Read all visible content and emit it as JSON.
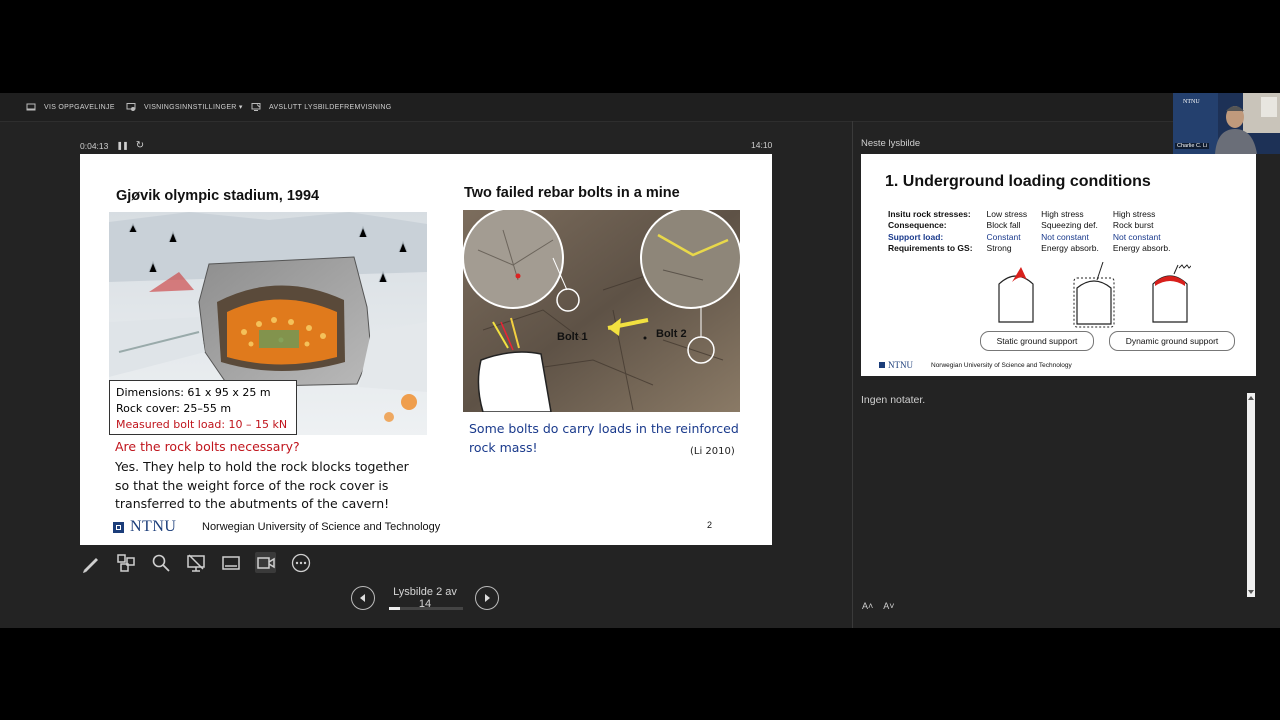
{
  "topbar": {
    "items": [
      {
        "label": "VIS OPPGAVELINJE",
        "icon": "taskbar-icon"
      },
      {
        "label": "VISNINGSINNSTILLINGER ▾",
        "icon": "display-settings-icon"
      },
      {
        "label": "AVSLUTT LYSBILDEFREMVISNING",
        "icon": "end-slideshow-icon"
      }
    ]
  },
  "timer": {
    "elapsed": "0:04:13",
    "clock": "14:10"
  },
  "slide": {
    "left_title": "Gjøvik olympic stadium, 1994",
    "right_title": "Two failed rebar bolts in a mine",
    "info": {
      "line1": "Dimensions: 61 x 95 x 25 m",
      "line2": "Rock cover: 25–55 m",
      "line3": "Measured bolt load: 10 – 15 kN"
    },
    "question": "Are the rock bolts necessary?",
    "answer": "Yes. They help to hold the rock blocks together so that the weight force of the rock cover is transferred to the abutments of the cavern!",
    "bolt1": "Bolt 1",
    "bolt2": "Bolt 2",
    "caption": "Some bolts do carry loads in the reinforced rock mass!",
    "citation": "(Li 2010)",
    "logo": "NTNU",
    "university": "Norwegian University of Science and Technology",
    "page": "2"
  },
  "navigation": {
    "label": "Lysbilde 2 av 14",
    "progress": 0.143
  },
  "next_slide": {
    "header": "Neste lysbilde",
    "title": "1. Underground loading conditions",
    "rows": [
      {
        "label": "Insitu rock stresses:",
        "c1": "Low stress",
        "c2": "High stress",
        "c3": "High stress"
      },
      {
        "label": "Consequence:",
        "c1": "Block fall",
        "c2": "Squeezing def.",
        "c3": "Rock burst"
      },
      {
        "label": "Support load:",
        "c1": "Constant",
        "c2": "Not constant",
        "c3": "Not constant"
      },
      {
        "label": "Requirements to GS:",
        "c1": "Strong",
        "c2": "Energy absorb.",
        "c3": "Energy absorb."
      }
    ],
    "static_label": "Static ground support",
    "dynamic_label": "Dynamic ground support",
    "logo": "NTNU",
    "university": "Norwegian University of Science and Technology"
  },
  "notes": {
    "text": "Ingen notater."
  },
  "font_controls": {
    "increase": "A˄",
    "decrease": "A˅"
  },
  "video": {
    "name": "Charlie C. Li",
    "badge": "NTNU"
  },
  "colors": {
    "accent_red": "#c0141c",
    "accent_blue": "#1a3a8c",
    "ntnu_blue": "#1b3d7a"
  }
}
